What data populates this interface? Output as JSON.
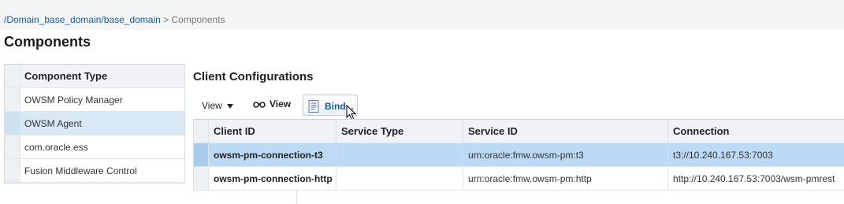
{
  "breadcrumb": {
    "link": "/Domain_base_domain/base_domain",
    "separator": ">",
    "current": "Components"
  },
  "page_title": "Components",
  "component_table": {
    "header": "Component Type",
    "rows": [
      {
        "label": "OWSM Policy Manager",
        "selected": false
      },
      {
        "label": "OWSM Agent",
        "selected": true
      },
      {
        "label": "com.oracle.ess",
        "selected": false
      },
      {
        "label": "Fusion Middleware Control",
        "selected": false
      }
    ]
  },
  "client_config": {
    "title": "Client Configurations",
    "toolbar": {
      "view_menu_label": "View",
      "view_button_label": "View",
      "view_button_icon": "glasses-icon",
      "bind_button_label": "Bind...",
      "bind_button_icon": "document-icon"
    },
    "columns": [
      "Client ID",
      "Service Type",
      "Service ID",
      "Connection"
    ],
    "rows": [
      {
        "client_id": "owsm-pm-connection-t3",
        "service_type": "",
        "service_id": "urn:oracle:fmw.owsm-pm:t3",
        "connection": "t3://10.240.167.53:7003",
        "selected": true
      },
      {
        "client_id": "owsm-pm-connection-http",
        "service_type": "",
        "service_id": "urn:oracle:fmw.owsm-pm:http",
        "connection": "http://10.240.167.53:7003/wsm-pmrest",
        "selected": false
      }
    ]
  },
  "colors": {
    "link": "#145c9e",
    "selected_row": "#bcdaf5",
    "selected_component": "#d9e8f5"
  }
}
